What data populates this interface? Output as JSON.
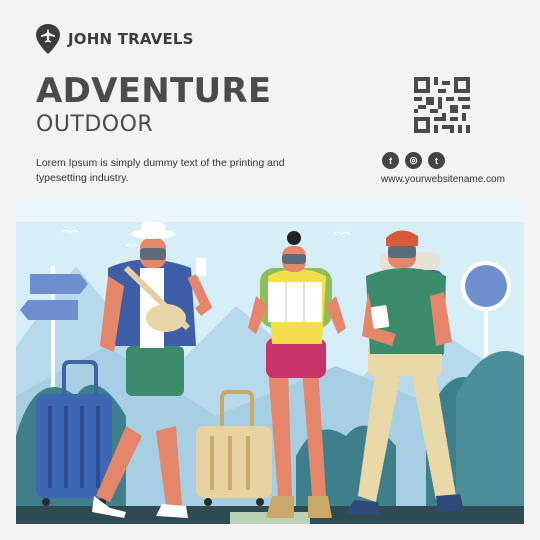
{
  "brand": {
    "name": "JOHN TRAVELS",
    "logo_icon": "airplane-pin-icon"
  },
  "hero": {
    "headline": "ADVENTURE",
    "subheadline": "OUTDOOR"
  },
  "body": {
    "text": "Lorem Ipsum is simply dummy text of the printing and typesetting industry."
  },
  "contact": {
    "qr_icon": "qr-code-icon",
    "social_icons": [
      "facebook-icon",
      "instagram-icon",
      "twitter-icon"
    ],
    "social_glyphs": [
      "f",
      "◎",
      "t"
    ],
    "website": "www.yourwebsitename.com"
  },
  "illustration": {
    "subject": "three-travelers-with-luggage",
    "icons": [
      "signpost-icon",
      "round-sign-icon",
      "blue-suitcase-icon",
      "yellow-suitcase-icon"
    ]
  },
  "colors": {
    "text_dark": "#4b4b4b",
    "sky": "#d6eef7",
    "mountain": "#b7d9ec",
    "tree": "#3f7f8c",
    "ground": "#2f4a52"
  }
}
